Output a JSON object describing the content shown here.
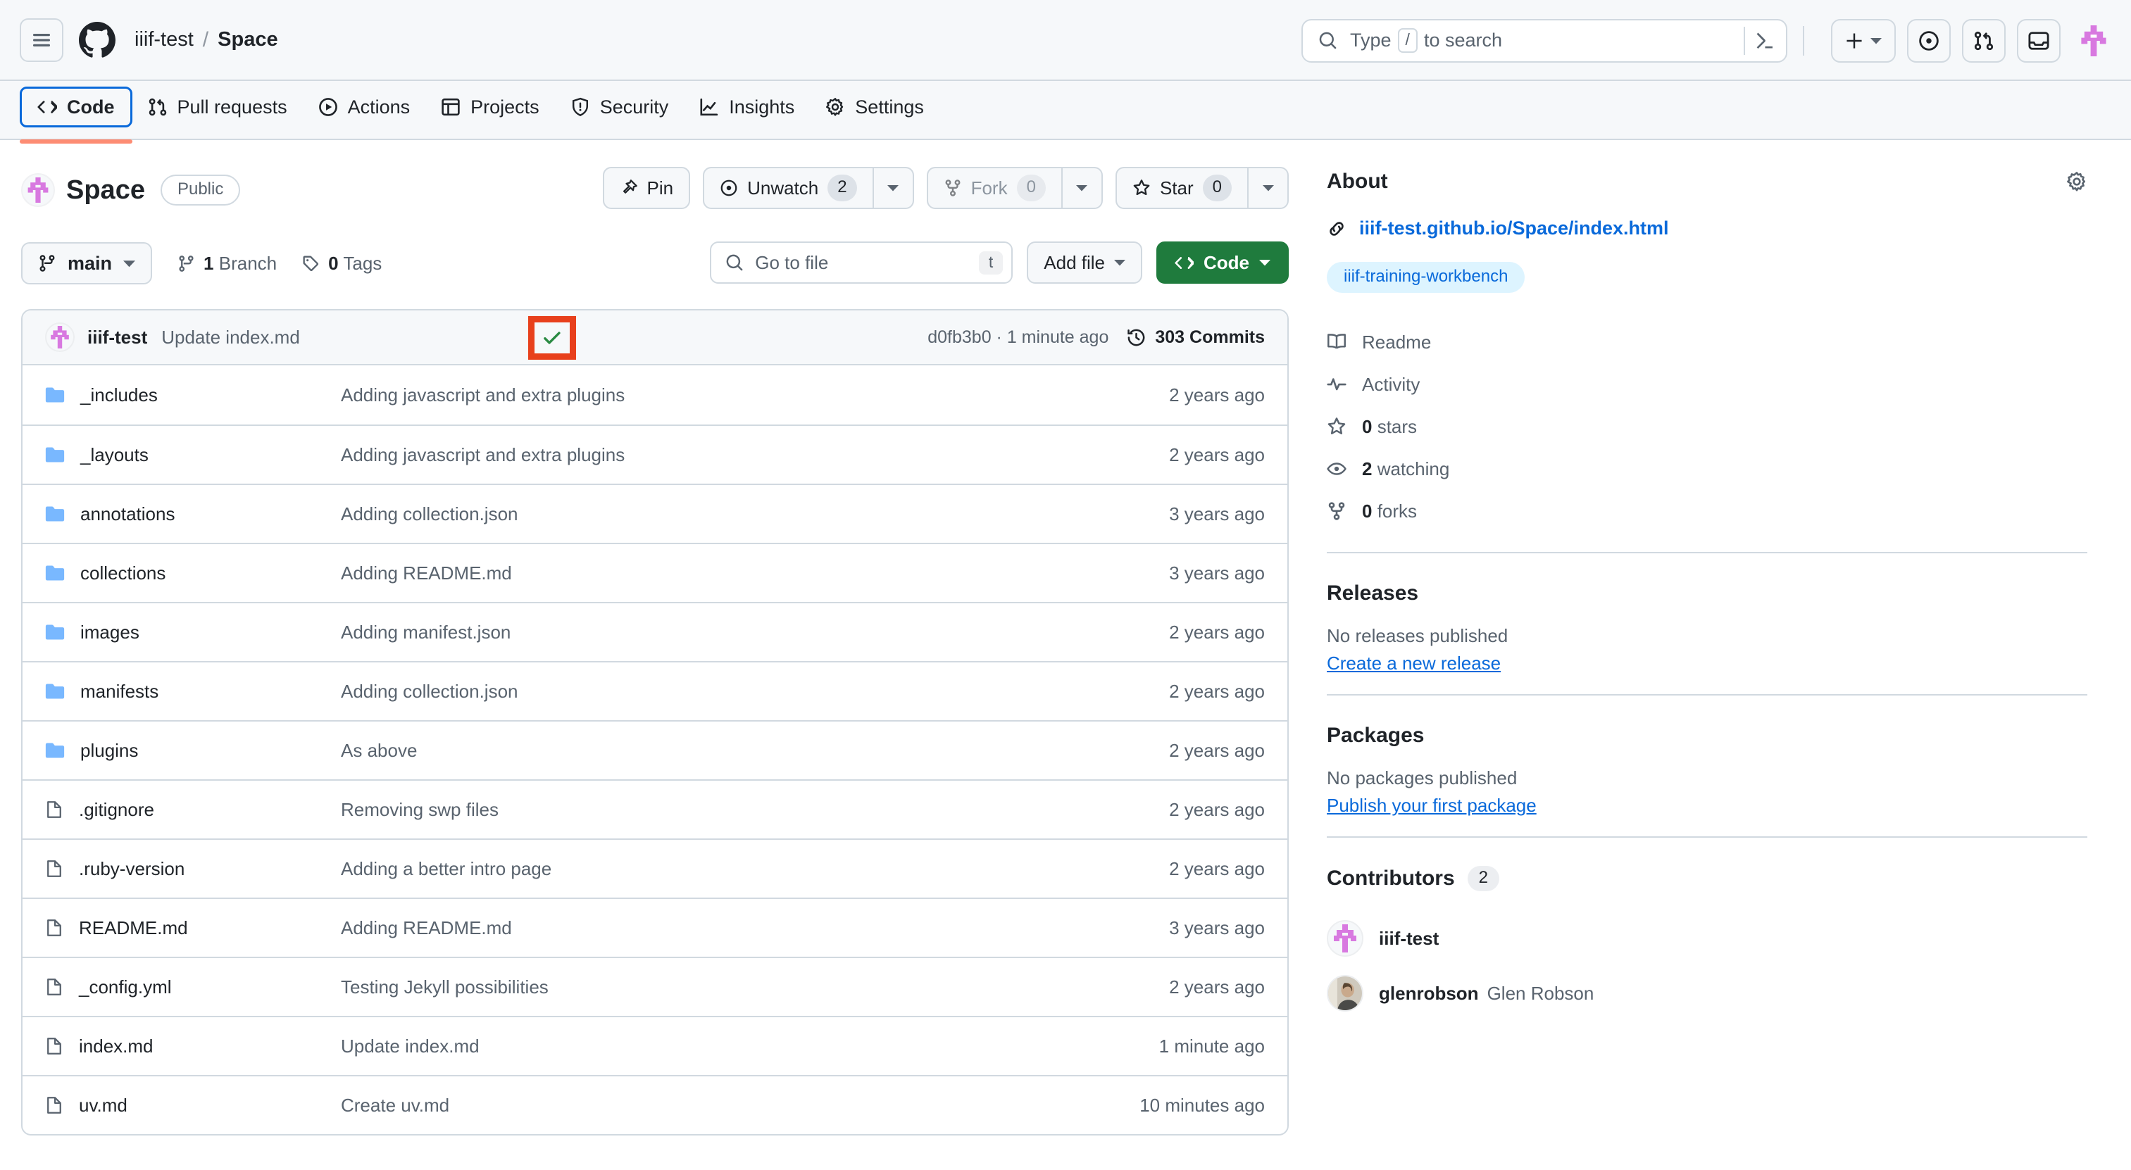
{
  "header": {
    "owner": "iiif-test",
    "separator": "/",
    "repo": "Space",
    "search_placeholder_prefix": "Type",
    "search_kbd": "/",
    "search_placeholder_suffix": "to search"
  },
  "repo_nav": {
    "tabs": [
      {
        "label": "Code",
        "icon": "code-icon",
        "active": true
      },
      {
        "label": "Pull requests",
        "icon": "git-pull-request-icon",
        "active": false
      },
      {
        "label": "Actions",
        "icon": "play-icon",
        "active": false
      },
      {
        "label": "Projects",
        "icon": "table-icon",
        "active": false
      },
      {
        "label": "Security",
        "icon": "shield-icon",
        "active": false
      },
      {
        "label": "Insights",
        "icon": "graph-icon",
        "active": false
      },
      {
        "label": "Settings",
        "icon": "gear-icon",
        "active": false
      }
    ]
  },
  "repo_header": {
    "name": "Space",
    "visibility": "Public",
    "pin_label": "Pin",
    "watch_label": "Unwatch",
    "watch_count": "2",
    "fork_label": "Fork",
    "fork_count": "0",
    "star_label": "Star",
    "star_count": "0"
  },
  "toolbar": {
    "branch": "main",
    "branch_count": "1",
    "branch_word": "Branch",
    "tag_count": "0",
    "tag_word": "Tags",
    "file_search_placeholder": "Go to file",
    "file_search_kbd": "t",
    "add_file_label": "Add file",
    "code_label": "Code"
  },
  "commit_bar": {
    "author": "iiif-test",
    "message": "Update index.md",
    "status_icon": "check-icon",
    "hash_and_time": "d0fb3b0 · 1 minute ago",
    "commits_label": "303 Commits"
  },
  "files": [
    {
      "name": "_includes",
      "type": "folder",
      "message": "Adding javascript and extra plugins",
      "age": "2 years ago"
    },
    {
      "name": "_layouts",
      "type": "folder",
      "message": "Adding javascript and extra plugins",
      "age": "2 years ago"
    },
    {
      "name": "annotations",
      "type": "folder",
      "message": "Adding collection.json",
      "age": "3 years ago"
    },
    {
      "name": "collections",
      "type": "folder",
      "message": "Adding README.md",
      "age": "3 years ago"
    },
    {
      "name": "images",
      "type": "folder",
      "message": "Adding manifest.json",
      "age": "2 years ago"
    },
    {
      "name": "manifests",
      "type": "folder",
      "message": "Adding collection.json",
      "age": "2 years ago"
    },
    {
      "name": "plugins",
      "type": "folder",
      "message": "As above",
      "age": "2 years ago"
    },
    {
      "name": ".gitignore",
      "type": "file",
      "message": "Removing swp files",
      "age": "2 years ago"
    },
    {
      "name": ".ruby-version",
      "type": "file",
      "message": "Adding a better intro page",
      "age": "2 years ago"
    },
    {
      "name": "README.md",
      "type": "file",
      "message": "Adding README.md",
      "age": "3 years ago"
    },
    {
      "name": "_config.yml",
      "type": "file",
      "message": "Testing Jekyll possibilities",
      "age": "2 years ago"
    },
    {
      "name": "index.md",
      "type": "file",
      "message": "Update index.md",
      "age": "1 minute ago"
    },
    {
      "name": "uv.md",
      "type": "file",
      "message": "Create uv.md",
      "age": "10 minutes ago"
    }
  ],
  "about": {
    "title": "About",
    "website": "iiif-test.github.io/Space/index.html",
    "topic": "iiif-training-workbench",
    "items": [
      {
        "icon": "book-icon",
        "label": "Readme",
        "value": ""
      },
      {
        "icon": "pulse-icon",
        "label": "Activity",
        "value": ""
      },
      {
        "icon": "star-icon",
        "label": "stars",
        "value": "0"
      },
      {
        "icon": "eye-icon",
        "label": "watching",
        "value": "2"
      },
      {
        "icon": "fork-icon",
        "label": "forks",
        "value": "0"
      }
    ]
  },
  "releases": {
    "title": "Releases",
    "empty": "No releases published",
    "action": "Create a new release"
  },
  "packages": {
    "title": "Packages",
    "empty": "No packages published",
    "action": "Publish your first package"
  },
  "contributors": {
    "title": "Contributors",
    "count": "2",
    "people": [
      {
        "login": "iiif-test",
        "name": ""
      },
      {
        "login": "glenrobson",
        "name": "Glen Robson"
      }
    ]
  },
  "colors": {
    "accent_blue": "#0969da",
    "green_button": "#1f7b3d",
    "highlight_red": "#e8401c",
    "folder_blue": "#79b8ff",
    "identicon_pink": "#d879e0",
    "tab_underline": "#fd8c73"
  }
}
